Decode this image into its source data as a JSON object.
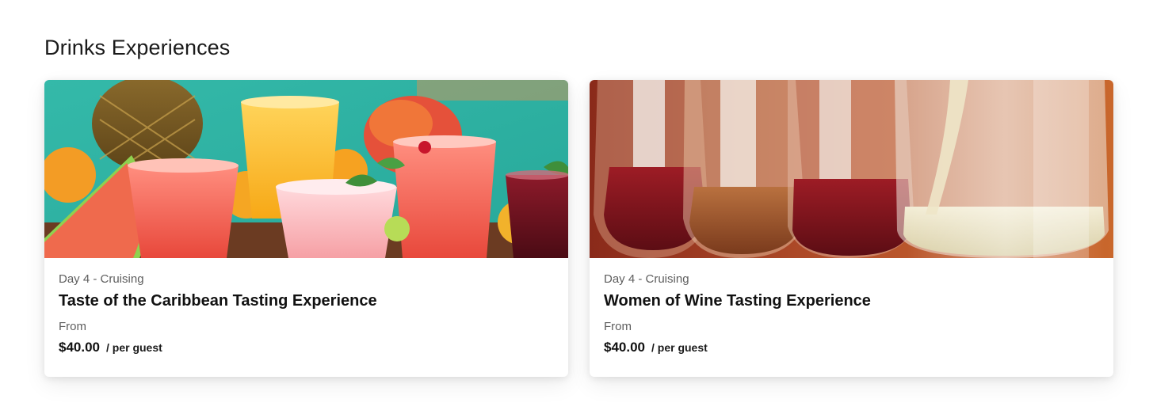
{
  "section": {
    "title": "Drinks Experiences"
  },
  "cards": [
    {
      "day": "Day 4 - Cruising",
      "title": "Taste of the Caribbean Tasting Experience",
      "from_label": "From",
      "price": "$40.00",
      "per_label": "/ per guest",
      "image_icon": "tropical-drinks-photo"
    },
    {
      "day": "Day 4 - Cruising",
      "title": "Women of Wine Tasting Experience",
      "from_label": "From",
      "price": "$40.00",
      "per_label": "/ per guest",
      "image_icon": "wine-glasses-photo"
    }
  ],
  "colors": {
    "heading": "#1b1b1b",
    "muted": "#5e5e5e",
    "card_bg": "#ffffff"
  }
}
